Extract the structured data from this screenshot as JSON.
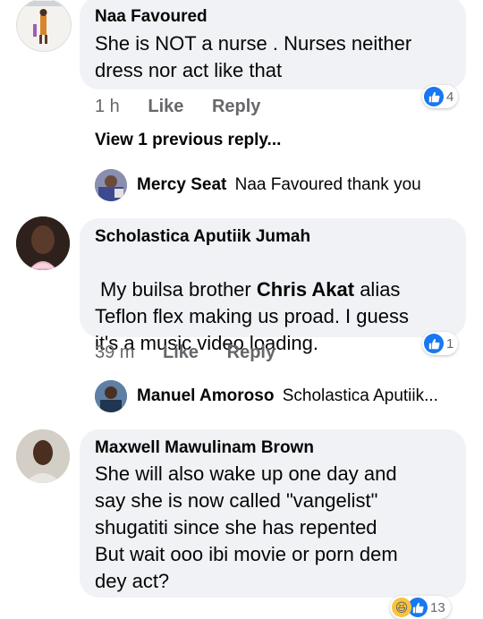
{
  "comments": [
    {
      "author": "Naa Favoured",
      "text": "She is NOT a nurse . Nurses neither\ndress nor act like that",
      "time": "1 h",
      "like": "Like",
      "reply": "Reply",
      "reaction_count": "4"
    },
    {
      "author": "Scholastica Aputiik Jumah",
      "text_before": "My builsa brother ",
      "text_bold": "Chris Akat",
      "text_after": "  alias\nTeflon flex making us proad. I guess\nit's a music video loading.",
      "time": "39 m",
      "like": "Like",
      "reply": "Reply",
      "reaction_count": "1"
    },
    {
      "author": "Maxwell Mawulinam Brown",
      "text": "She will also wake up one day and\nsay she is now called \"vangelist\"\nshugatiti since she has repented\nBut wait ooo ibi movie or porn dem\ndey act?",
      "reaction_count": "13"
    }
  ],
  "view_previous": "View 1 previous reply...",
  "replies": [
    {
      "author": "Mercy Seat",
      "text": "Naa Favoured thank you"
    },
    {
      "author": "Manuel Amoroso",
      "text": "Scholastica Aputiik..."
    }
  ],
  "colors": {
    "like_blue": "#1877f2",
    "bubble_bg": "#f0f2f5",
    "meta_gray": "#65676b"
  }
}
